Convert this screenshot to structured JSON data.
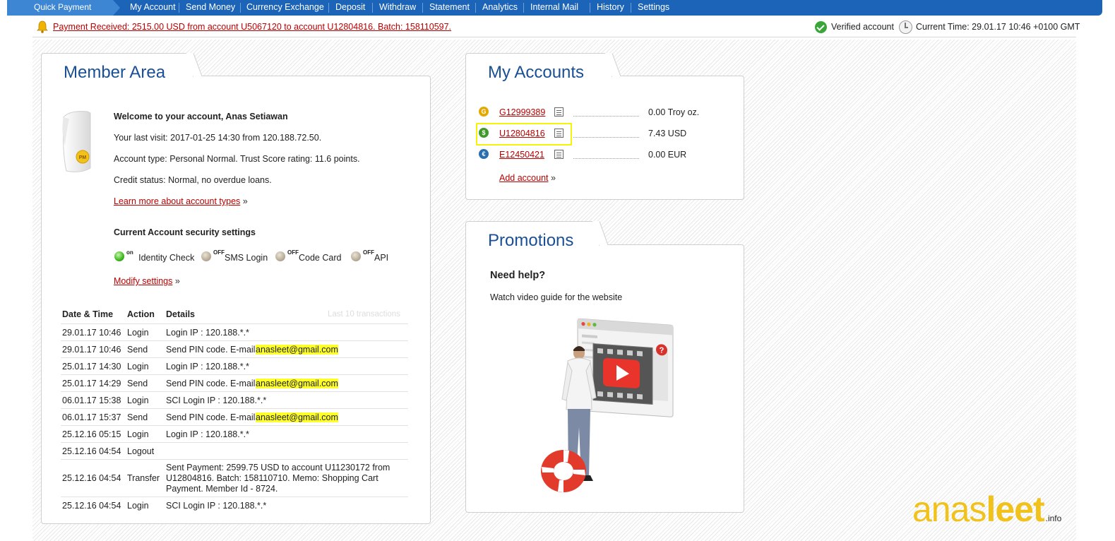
{
  "nav": {
    "quick_payment": "Quick Payment",
    "items": [
      "My Account",
      "Send Money",
      "Currency Exchange",
      "Deposit",
      "Withdraw",
      "Statement",
      "Analytics",
      "Internal Mail",
      "History",
      "Settings"
    ]
  },
  "notice": {
    "payment": "Payment Received: 2515.00 USD from account U5067120 to account U12804816. Batch: 158110597.",
    "verified": "Verified account",
    "time": "Current Time: 29.01.17 10:46 +0100 GMT"
  },
  "member": {
    "title": "Member Area",
    "welcome": "Welcome to your account, Anas Setiawan",
    "last_visit": "Your last visit: 2017-01-25 14:30 from 120.188.72.50.",
    "account_type": "Account type: Personal Normal. Trust Score rating: 11.6 points.",
    "credit": "Credit status: Normal, no overdue loans.",
    "learn_more": "Learn more about account types",
    "security_title": "Current Account security settings",
    "security": [
      {
        "state": "on",
        "label": "Identity Check"
      },
      {
        "state": "OFF",
        "label": "SMS Login"
      },
      {
        "state": "OFF",
        "label": "Code Card"
      },
      {
        "state": "OFF",
        "label": "API"
      }
    ],
    "modify": "Modify settings",
    "raquo": "»"
  },
  "transactions": {
    "headers": {
      "date": "Date & Time",
      "action": "Action",
      "details": "Details"
    },
    "last10": "Last 10 transactions",
    "rows": [
      {
        "date": "29.01.17 10:46",
        "action": "Login",
        "details": "Login IP : 120.188.*.*"
      },
      {
        "date": "29.01.17 10:46",
        "action": "Send",
        "details": "Send PIN code. E-mail ",
        "email": "anasleet@gmail.com"
      },
      {
        "date": "25.01.17 14:30",
        "action": "Login",
        "details": "Login IP : 120.188.*.*"
      },
      {
        "date": "25.01.17 14:29",
        "action": "Send",
        "details": "Send PIN code. E-mail ",
        "email": "anasleet@gmail.com"
      },
      {
        "date": "06.01.17 15:38",
        "action": "Login",
        "details": "SCI Login IP : 120.188.*.*"
      },
      {
        "date": "06.01.17 15:37",
        "action": "Send",
        "details": "Send PIN code. E-mail ",
        "email": "anasleet@gmail.com"
      },
      {
        "date": "25.12.16 05:15",
        "action": "Login",
        "details": "Login IP : 120.188.*.*"
      },
      {
        "date": "25.12.16 04:54",
        "action": "Logout",
        "details": ""
      },
      {
        "date": "25.12.16 04:54",
        "action": "Transfer",
        "details_lines": [
          "Sent Payment: 2599.75 USD to account U11230172 from",
          "U12804816. Batch: 158110710. Memo: Shopping Cart",
          "Payment. Member Id - 8724."
        ]
      },
      {
        "date": "25.12.16 04:54",
        "action": "Login",
        "details": "SCI Login IP : 120.188.*.*"
      }
    ]
  },
  "accounts": {
    "title": "My Accounts",
    "list": [
      {
        "icon": "gold-coin-icon",
        "id": "G12999389",
        "balance": "0.00 Troy oz.",
        "color": "#e5a800"
      },
      {
        "icon": "dollar-coin-icon",
        "id": "U12804816",
        "balance": "7.43 USD",
        "color": "#3f9a2a"
      },
      {
        "icon": "euro-coin-icon",
        "id": "E12450421",
        "balance": "0.00 EUR",
        "color": "#2a6fb0"
      }
    ],
    "add": "Add account"
  },
  "promotions": {
    "title": "Promotions",
    "heading": "Need help?",
    "text": "Watch video guide for the website"
  },
  "watermark": {
    "light": "anas",
    "bold": "leet",
    "suffix": ".info"
  },
  "colors": {
    "nav": "#1c64b8",
    "quick_payment": "#3d86d4",
    "title": "#1a4f96",
    "link": "#bb0000",
    "highlight": "#ffff2a"
  }
}
